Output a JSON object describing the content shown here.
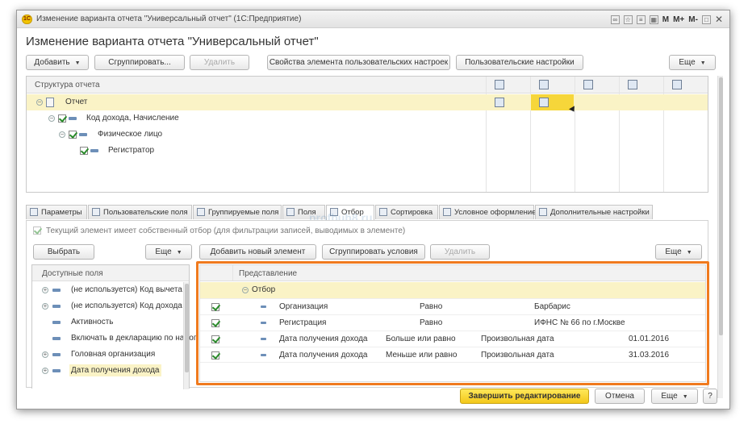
{
  "window": {
    "title": "Изменение варианта отчета \"Универсальный отчет\"  (1С:Предприятие)",
    "logo": "1С",
    "toolbar_m": "M",
    "toolbar_mplus": "M+",
    "toolbar_mminus": "M-"
  },
  "form": {
    "title": "Изменение варианта отчета \"Универсальный отчет\""
  },
  "toolbar": {
    "add": "Добавить",
    "group": "Сгруппировать...",
    "delete": "Удалить",
    "element_props": "Свойства элемента пользовательских настроек",
    "user_settings": "Пользовательские настройки",
    "more": "Еще"
  },
  "structure": {
    "header": "Структура отчета",
    "rows": [
      {
        "label": "Отчет"
      },
      {
        "label": "Код дохода, Начисление"
      },
      {
        "label": "Физическое лицо"
      },
      {
        "label": "Регистратор"
      }
    ]
  },
  "tabs": [
    {
      "label": "Параметры"
    },
    {
      "label": "Пользовательские поля"
    },
    {
      "label": "Группируемые поля"
    },
    {
      "label": "Поля"
    },
    {
      "label": "Отбор"
    },
    {
      "label": "Сортировка"
    },
    {
      "label": "Условное оформление"
    },
    {
      "label": "Дополнительные настройки"
    }
  ],
  "filter": {
    "own_filter_label": "Текущий элемент имеет собственный отбор (для фильтрации записей, выводимых в элементе)",
    "select": "Выбрать",
    "more_left": "Еще",
    "add_element": "Добавить новый элемент",
    "group_conditions": "Сгруппировать условия",
    "delete": "Удалить",
    "more_right": "Еще",
    "available_header": "Доступные поля",
    "available": [
      {
        "label": "(не используется) Код вычета"
      },
      {
        "label": "(не используется) Код дохода"
      },
      {
        "label": "Активность"
      },
      {
        "label": "Включать в декларацию по налог"
      },
      {
        "label": "Головная организация"
      },
      {
        "label": "Дата получения дохода"
      }
    ],
    "grid_header": "Представление",
    "group_row": "Отбор",
    "rows": [
      {
        "field": "Организация",
        "condition": "Равно",
        "kind": "",
        "value": "Барбарис"
      },
      {
        "field": "Регистрация",
        "condition": "Равно",
        "kind": "",
        "value": "ИФНС № 66 по г.Москве"
      },
      {
        "field": "Дата получения дохода",
        "condition": "Больше или равно",
        "kind": "Произвольная дата",
        "value": "01.01.2016"
      },
      {
        "field": "Дата получения дохода",
        "condition": "Меньше или равно",
        "kind": "Произвольная дата",
        "value": "31.03.2016"
      }
    ]
  },
  "footer": {
    "finish": "Завершить редактирование",
    "cancel": "Отмена",
    "more": "Еще",
    "help": "?"
  },
  "watermark": "profbuh8.ru",
  "colors": {
    "highlight": "#f07a1e",
    "selected_row": "#faf3c6",
    "primary_button": "#f3c81a"
  }
}
